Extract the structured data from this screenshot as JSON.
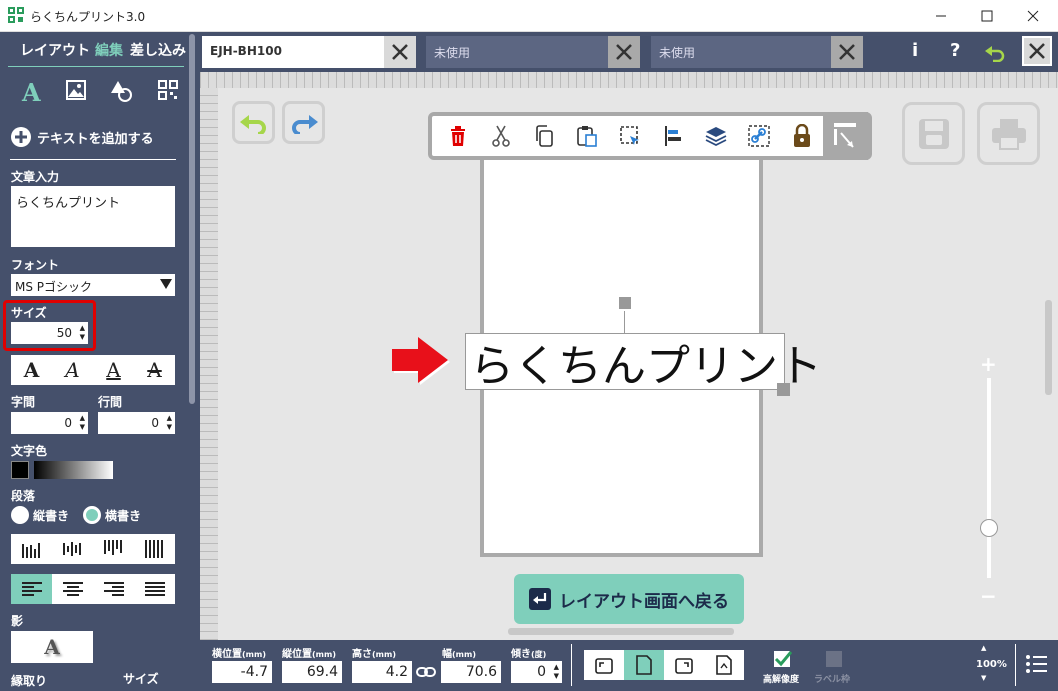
{
  "app": {
    "title": "らくちんプリント3.0"
  },
  "mode_tabs": {
    "layout": "レイアウト",
    "edit": "編集",
    "merge": "差し込み"
  },
  "sidebar": {
    "add_text": "テキストを追加する",
    "text_input_label": "文章入力",
    "text_input_value": "らくちんプリント",
    "font_label": "フォント",
    "font_value": "MS Pゴシック",
    "size_label": "サイズ",
    "size_value": "50",
    "char_spacing_label": "字間",
    "char_spacing_value": "0",
    "line_spacing_label": "行間",
    "line_spacing_value": "0",
    "text_color_label": "文字色",
    "paragraph_label": "段落",
    "vertical_label": "縦書き",
    "horizontal_label": "横書き",
    "shadow_label": "影",
    "outline_label": "縁取り",
    "outline_size_label": "サイズ",
    "text_style_glyph": "A",
    "selected_orientation": "horizontal",
    "selected_align": "left"
  },
  "tabs": [
    {
      "label": "EJH-BH100",
      "active": true
    },
    {
      "label": "未使用",
      "active": false
    },
    {
      "label": "未使用",
      "active": false
    }
  ],
  "top_right": {
    "info": "i",
    "help": "?"
  },
  "canvas": {
    "text": "らくちんプリント",
    "back_button": "レイアウト画面へ戻る",
    "zoom_plus": "+",
    "zoom_minus": "−",
    "zoom_level": 0.25
  },
  "bottom": {
    "x_label": "横位置",
    "x_unit": "(mm)",
    "x_value": "-4.7",
    "y_label": "縦位置",
    "y_unit": "(mm)",
    "y_value": "69.4",
    "h_label": "高さ",
    "h_unit": "(mm)",
    "h_value": "4.2",
    "w_label": "幅",
    "w_unit": "(mm)",
    "w_value": "70.6",
    "rot_label": "傾き",
    "rot_unit": "(度)",
    "rot_value": "0",
    "high_res_label": "高解像度",
    "label_frame_label": "ラベル枠",
    "zoom_value": "100%"
  },
  "colors": {
    "sidebar": "#45506b",
    "accent": "#7fcfbb",
    "highlight": "#e00000",
    "arrow": "#e8101a"
  }
}
